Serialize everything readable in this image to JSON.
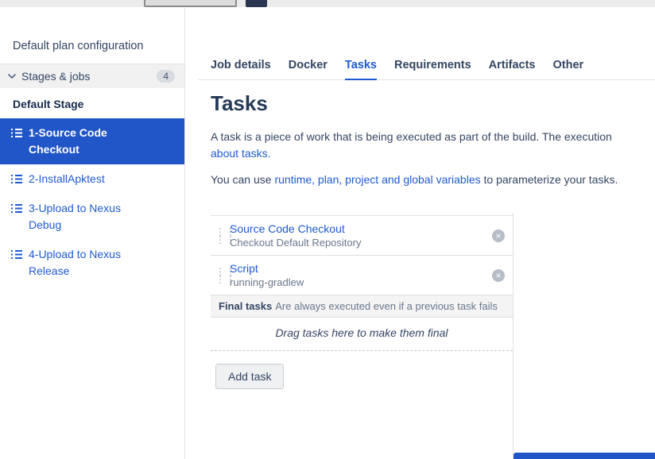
{
  "colors": {
    "accent_blue": "#1f5bd0",
    "selected_bg": "#2156c8",
    "text_dark": "#344563",
    "text_muted": "#6b778c",
    "border": "#e0e0e0"
  },
  "sidebar": {
    "title": "Default plan configuration",
    "stages_section": {
      "label": "Stages & jobs",
      "badge": "4"
    },
    "stage_name": "Default Stage",
    "jobs": [
      {
        "label": "1-Source Code Checkout"
      },
      {
        "label": "2-InstallApktest"
      },
      {
        "label": "3-Upload to Nexus Debug"
      },
      {
        "label": "4-Upload to Nexus Release"
      }
    ]
  },
  "tabs": [
    {
      "label": "Job details"
    },
    {
      "label": "Docker"
    },
    {
      "label": "Tasks"
    },
    {
      "label": "Requirements"
    },
    {
      "label": "Artifacts"
    },
    {
      "label": "Other"
    }
  ],
  "main": {
    "heading": "Tasks",
    "intro": {
      "text": "A task is a piece of work that is being executed as part of the build. The execution",
      "link": "about tasks."
    },
    "variables": {
      "prefix": "You can use ",
      "link": "runtime, plan, project and global variables",
      "suffix": " to parameterize your tasks."
    },
    "tasks": [
      {
        "title": "Source Code Checkout",
        "subtitle": "Checkout Default Repository"
      },
      {
        "title": "Script",
        "subtitle": "running-gradlew"
      }
    ],
    "final_tasks": {
      "label": "Final tasks",
      "description": "Are always executed even if a previous task fails"
    },
    "drop_hint": "Drag tasks here to make them final",
    "add_task_label": "Add task"
  },
  "icons": {
    "drag_handle": "⋮⋮",
    "close": "×"
  }
}
